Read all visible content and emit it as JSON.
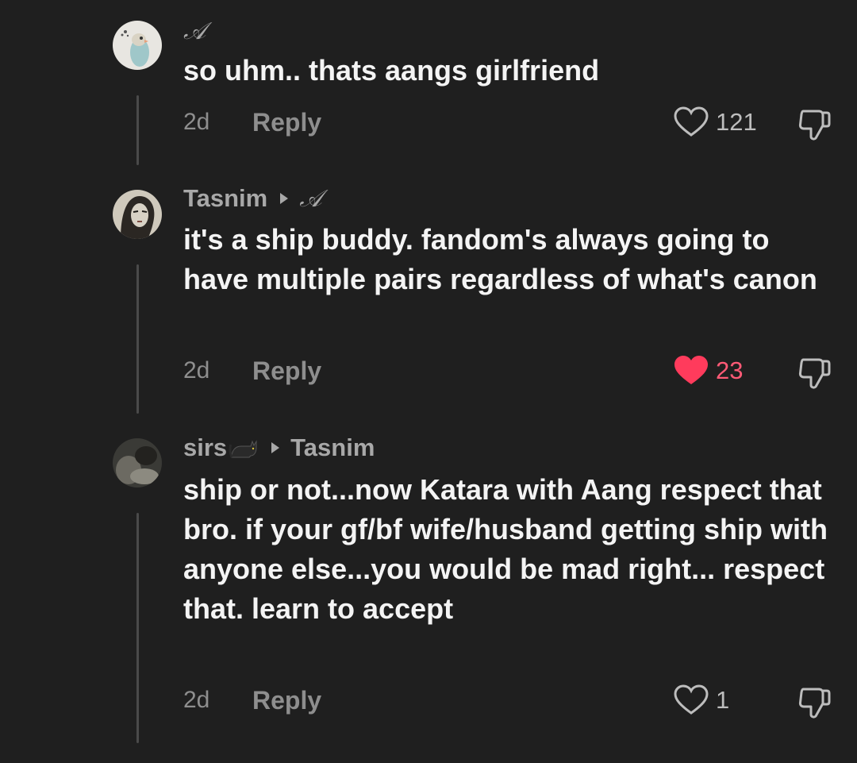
{
  "colors": {
    "background": "#1f1f1f",
    "liked_heart": "#ff3b5c",
    "liked_count": "#ff5a76",
    "muted": "#8e8e8e"
  },
  "comments": [
    {
      "username": "𝒜",
      "text": "so uhm.. thats aangs girlfriend",
      "time": "2d",
      "reply_label": "Reply",
      "likes": "121",
      "liked": false
    },
    {
      "username": "Tasnim",
      "reply_to": "𝒜",
      "text": "it's a ship buddy. fandom's always going to have multiple pairs regardless of what's canon",
      "time": "2d",
      "reply_label": "Reply",
      "likes": "23",
      "liked": true
    },
    {
      "username": "sirs",
      "username_emoji": "black-cat-emoji",
      "reply_to": "Tasnim",
      "text": "ship or not...now Katara with Aang respect that bro. if your gf/bf wife/husband getting ship with anyone else...you would be mad right... respect that. learn to accept",
      "time": "2d",
      "reply_label": "Reply",
      "likes": "1",
      "liked": false
    }
  ]
}
